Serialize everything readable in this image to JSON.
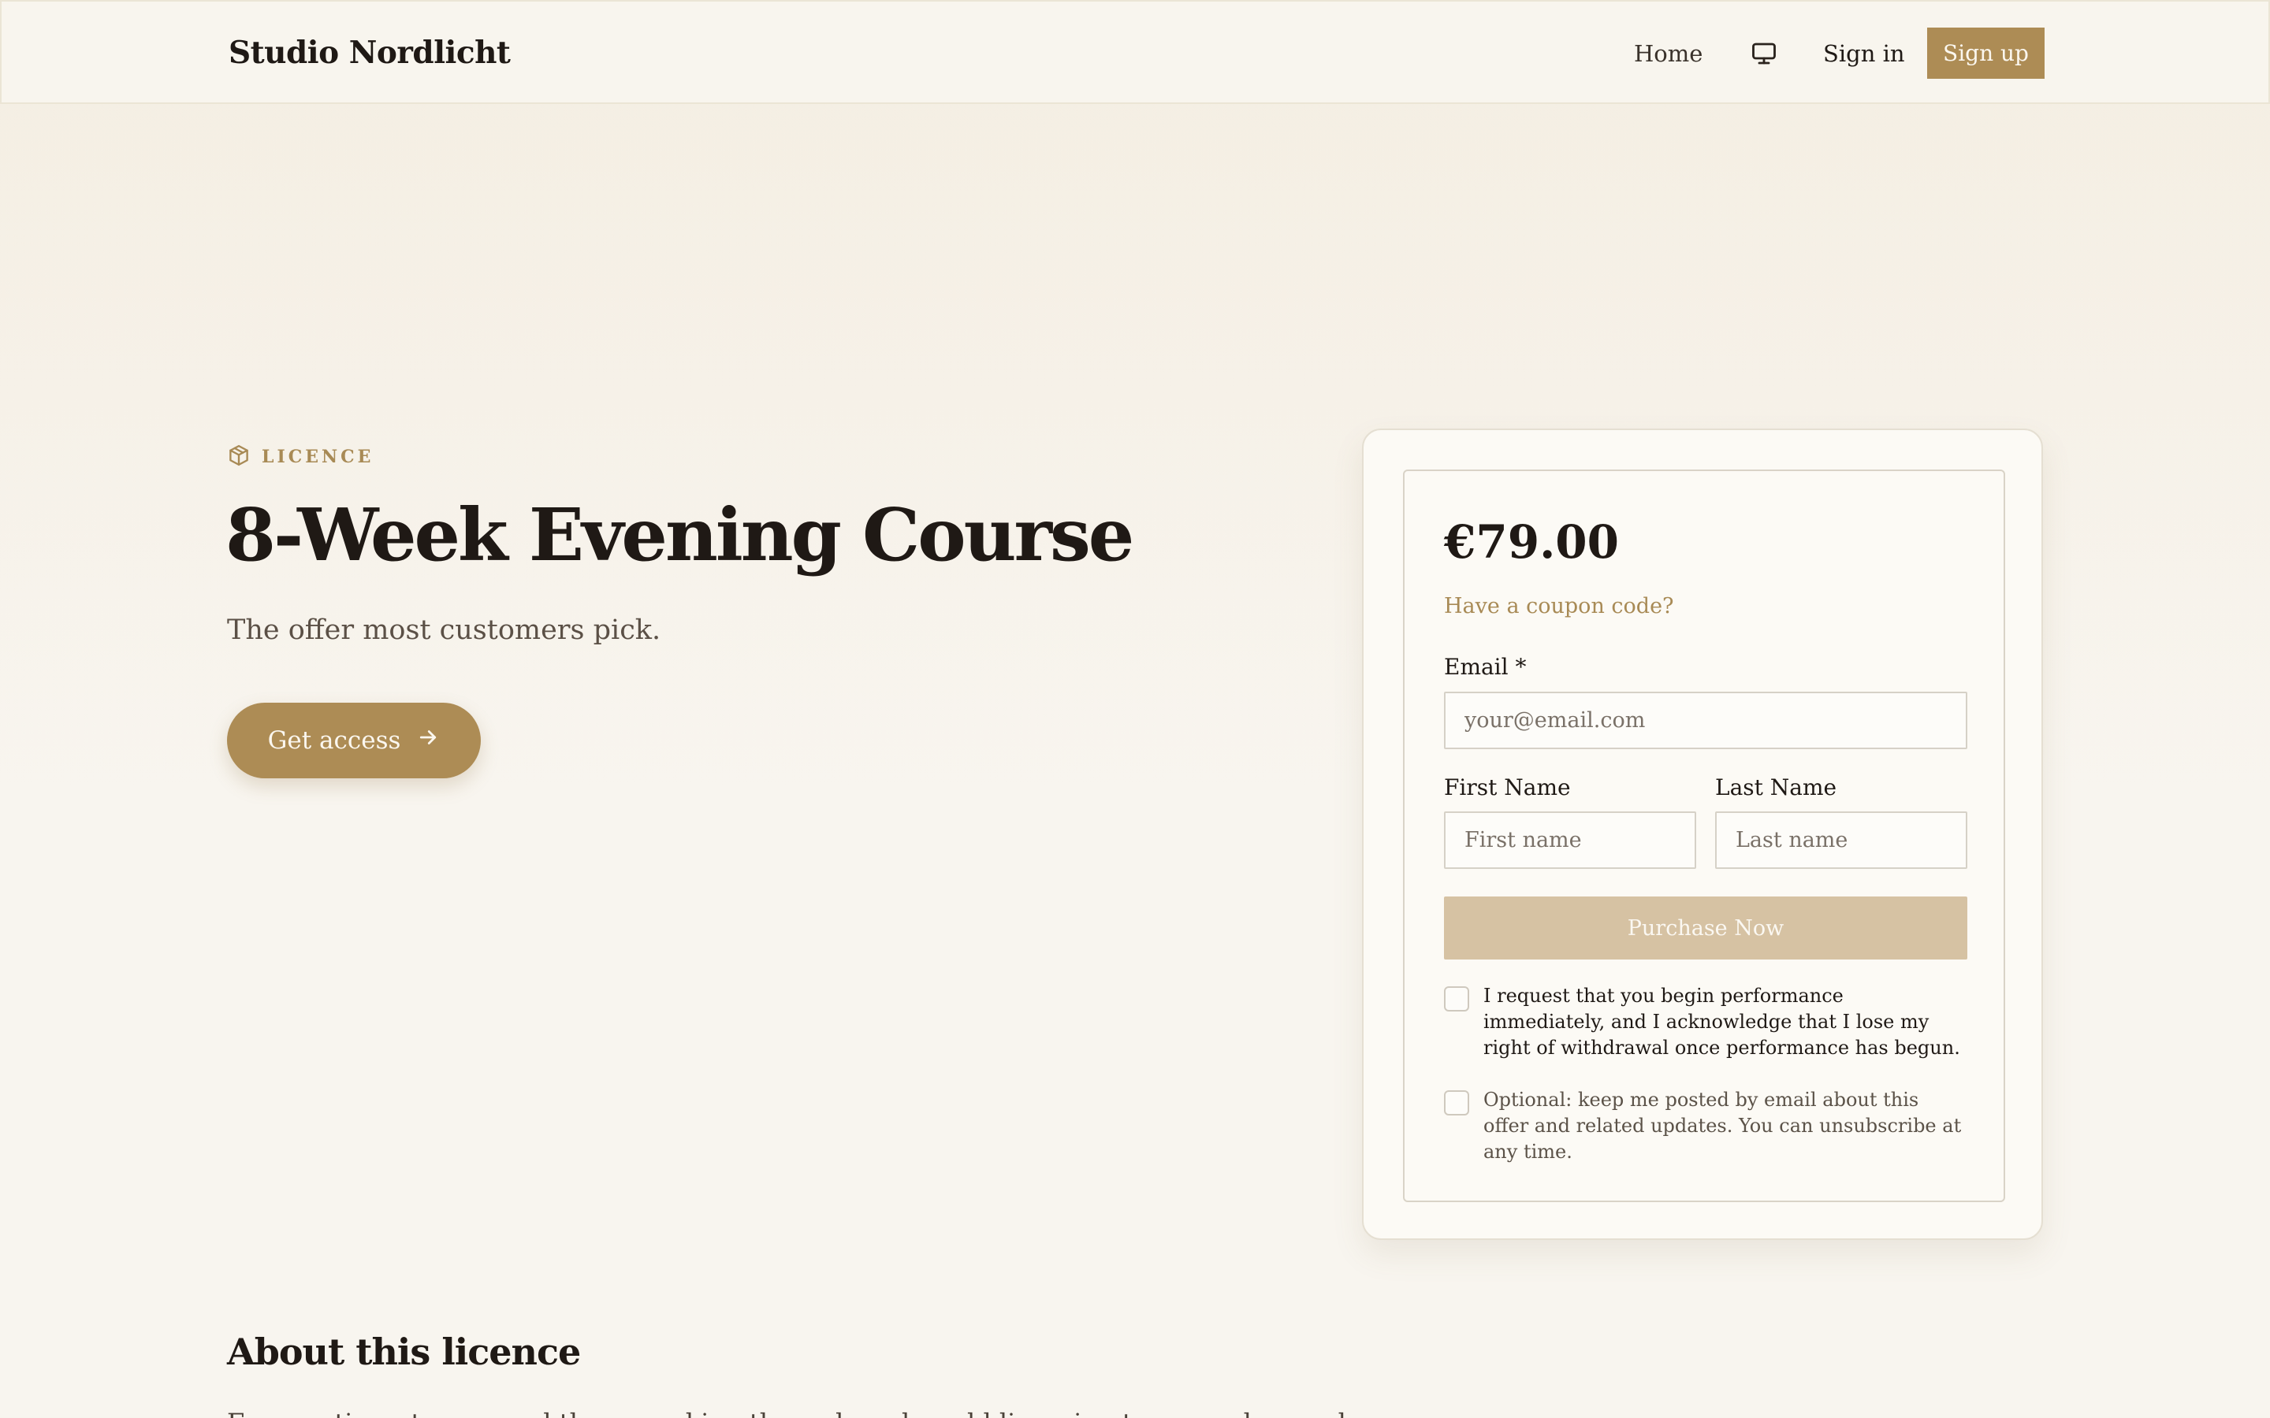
{
  "header": {
    "brand": "Studio Nordlicht",
    "nav": {
      "home": "Home",
      "display_icon": "monitor-icon",
      "sign_in": "Sign in",
      "sign_up": "Sign up"
    }
  },
  "hero": {
    "eyebrow_icon": "package-icon",
    "eyebrow": "LICENCE",
    "title": "8-Week Evening Course",
    "subtitle": "The offer most customers pick.",
    "cta_label": "Get access",
    "cta_icon": "arrow-right-icon"
  },
  "checkout": {
    "price": "€79.00",
    "coupon_link": "Have a coupon code?",
    "email_label": "Email *",
    "email_placeholder": "your@email.com",
    "first_name_label": "First Name",
    "first_name_placeholder": "First name",
    "last_name_label": "Last Name",
    "last_name_placeholder": "Last name",
    "purchase_label": "Purchase Now",
    "consent_withdrawal": "I request that you begin performance immediately, and I acknowledge that I lose my right of withdrawal once performance has begun.",
    "consent_newsletter": "Optional: keep me posted by email about this offer and related updates. You can unsubscribe at any time."
  },
  "about": {
    "title": "About this licence",
    "text": "For creatives, teams, and those working through real-world licensing terms and everyday use of"
  },
  "colors": {
    "accent": "#ad8c55",
    "accent_disabled": "#d6c2a3",
    "text": "#1f1915",
    "background": "#f8f5ef"
  }
}
